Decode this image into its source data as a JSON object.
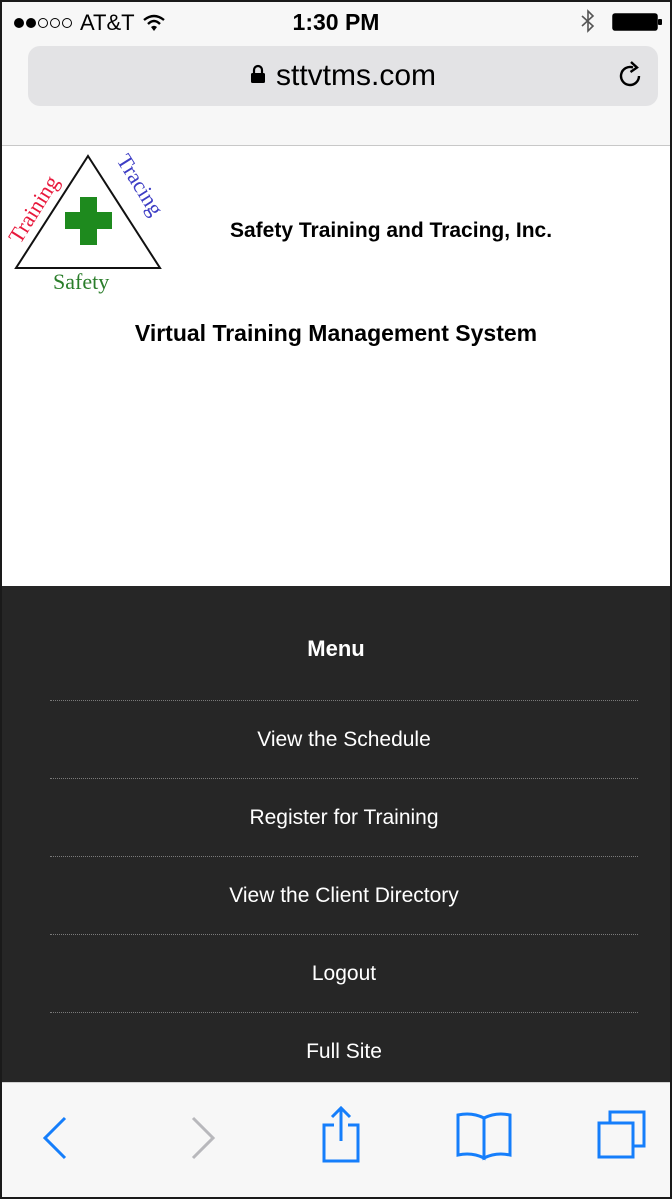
{
  "status_bar": {
    "carrier": "AT&T",
    "time": "1:30 PM",
    "signal_bars_filled": 2,
    "signal_bars_total": 5
  },
  "address_bar": {
    "url": "sttvtms.com",
    "icons": [
      "lock-icon",
      "reload-icon"
    ]
  },
  "logo": {
    "words": [
      "Training",
      "Tracing",
      "Safety"
    ],
    "colors": {
      "training": "#e8193c",
      "tracing": "#3d3dc4",
      "safety": "#2a7d2a",
      "cross": "#1e8a1e"
    }
  },
  "header": {
    "company_name": "Safety Training and Tracing, Inc.",
    "system_title": "Virtual Training Management System"
  },
  "menu": {
    "title": "Menu",
    "items": [
      {
        "label": "View the Schedule"
      },
      {
        "label": "Register for Training"
      },
      {
        "label": "View the Client Directory"
      },
      {
        "label": "Logout"
      },
      {
        "label": "Full Site"
      }
    ]
  },
  "toolbar": {
    "icons": [
      "back-icon",
      "forward-icon",
      "share-icon",
      "bookmarks-icon",
      "tabs-icon"
    ],
    "accent_color": "#157efb",
    "disabled_color": "#b8b8bc"
  }
}
